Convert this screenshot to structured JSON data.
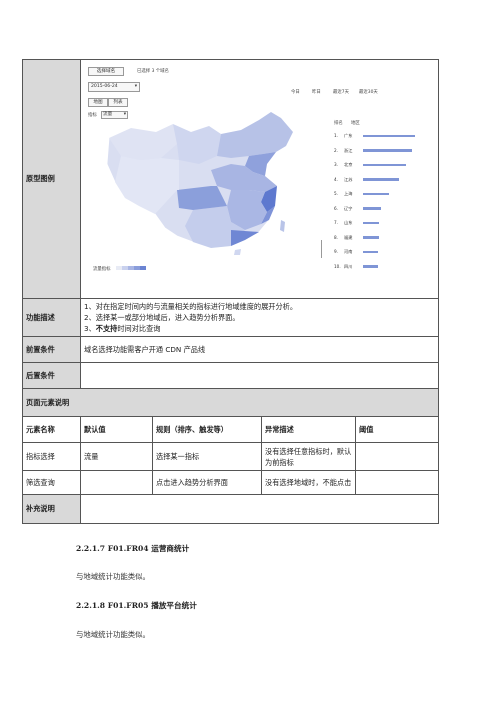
{
  "prototype": {
    "label": "原型图例",
    "select_domain_btn": "选择域名",
    "selected_text": "已选择 3 个域名",
    "date_value": "2015-06-24",
    "time_tabs": [
      "今日",
      "昨日",
      "最近7天",
      "最近30天"
    ],
    "view_btn_map": "地图",
    "view_btn_list": "列表",
    "metric_label": "指标",
    "metric_value": "流量",
    "ranking": {
      "col_rank": "排名",
      "col_region": "地区",
      "rows": [
        {
          "rank": "1.",
          "name": "广东",
          "value": 1.0
        },
        {
          "rank": "2.",
          "name": "浙江",
          "value": 0.95
        },
        {
          "rank": "3.",
          "name": "北京",
          "value": 0.82
        },
        {
          "rank": "4.",
          "name": "江苏",
          "value": 0.7
        },
        {
          "rank": "5.",
          "name": "上海",
          "value": 0.5
        },
        {
          "rank": "6.",
          "name": "辽宁",
          "value": 0.35
        },
        {
          "rank": "7.",
          "name": "山东",
          "value": 0.3
        },
        {
          "rank": "8.",
          "name": "福建",
          "value": 0.3
        },
        {
          "rank": "9.",
          "name": "河南",
          "value": 0.28
        },
        {
          "rank": "10.",
          "name": "四川",
          "value": 0.28
        }
      ]
    },
    "legend_label": "流量指标",
    "legend_colors": [
      "#e8ebf5",
      "#c9d1ee",
      "#a9b6e4",
      "#8a9ddb",
      "#6b84d2"
    ]
  },
  "rows": {
    "func_desc_label": "功能描述",
    "func_desc_items": [
      {
        "num": "1、",
        "text": "对在指定时间内的与流量相关的指标进行地域维度的展开分析。",
        "bold": ""
      },
      {
        "num": "2、",
        "text": "选择某一或部分地域后，进入趋势分析界面。",
        "bold": ""
      },
      {
        "num": "3、",
        "bold": "不支持",
        "text": "时间对比查询"
      }
    ],
    "precondition_label": "前置条件",
    "precondition_value": "域名选择功能需客户开通 CDN 产品线",
    "postcondition_label": "后置条件",
    "postcondition_value": "",
    "element_desc_label": "页面元素说明",
    "columns": [
      "元素名称",
      "默认值",
      "规则（排序、触发等）",
      "异常描述",
      "阈值"
    ],
    "elements": [
      {
        "name": "指标选择",
        "default": "流量",
        "rule": "选择某一指标",
        "error": "没有选择任意指标时，默认为前指标",
        "threshold": ""
      },
      {
        "name": "筛选查询",
        "default": "",
        "rule": "点击进入趋势分析界面",
        "error": "没有选择地域时，不能点击",
        "threshold": ""
      }
    ],
    "supplement_label": "补充说明",
    "supplement_value": ""
  },
  "sections": [
    {
      "heading": "2.2.1.7 F01.FR04  运营商统计",
      "text": "与地域统计功能类似。"
    },
    {
      "heading": "2.2.1.8 F01.FR05  播放平台统计",
      "text": "与地域统计功能类似。"
    }
  ]
}
